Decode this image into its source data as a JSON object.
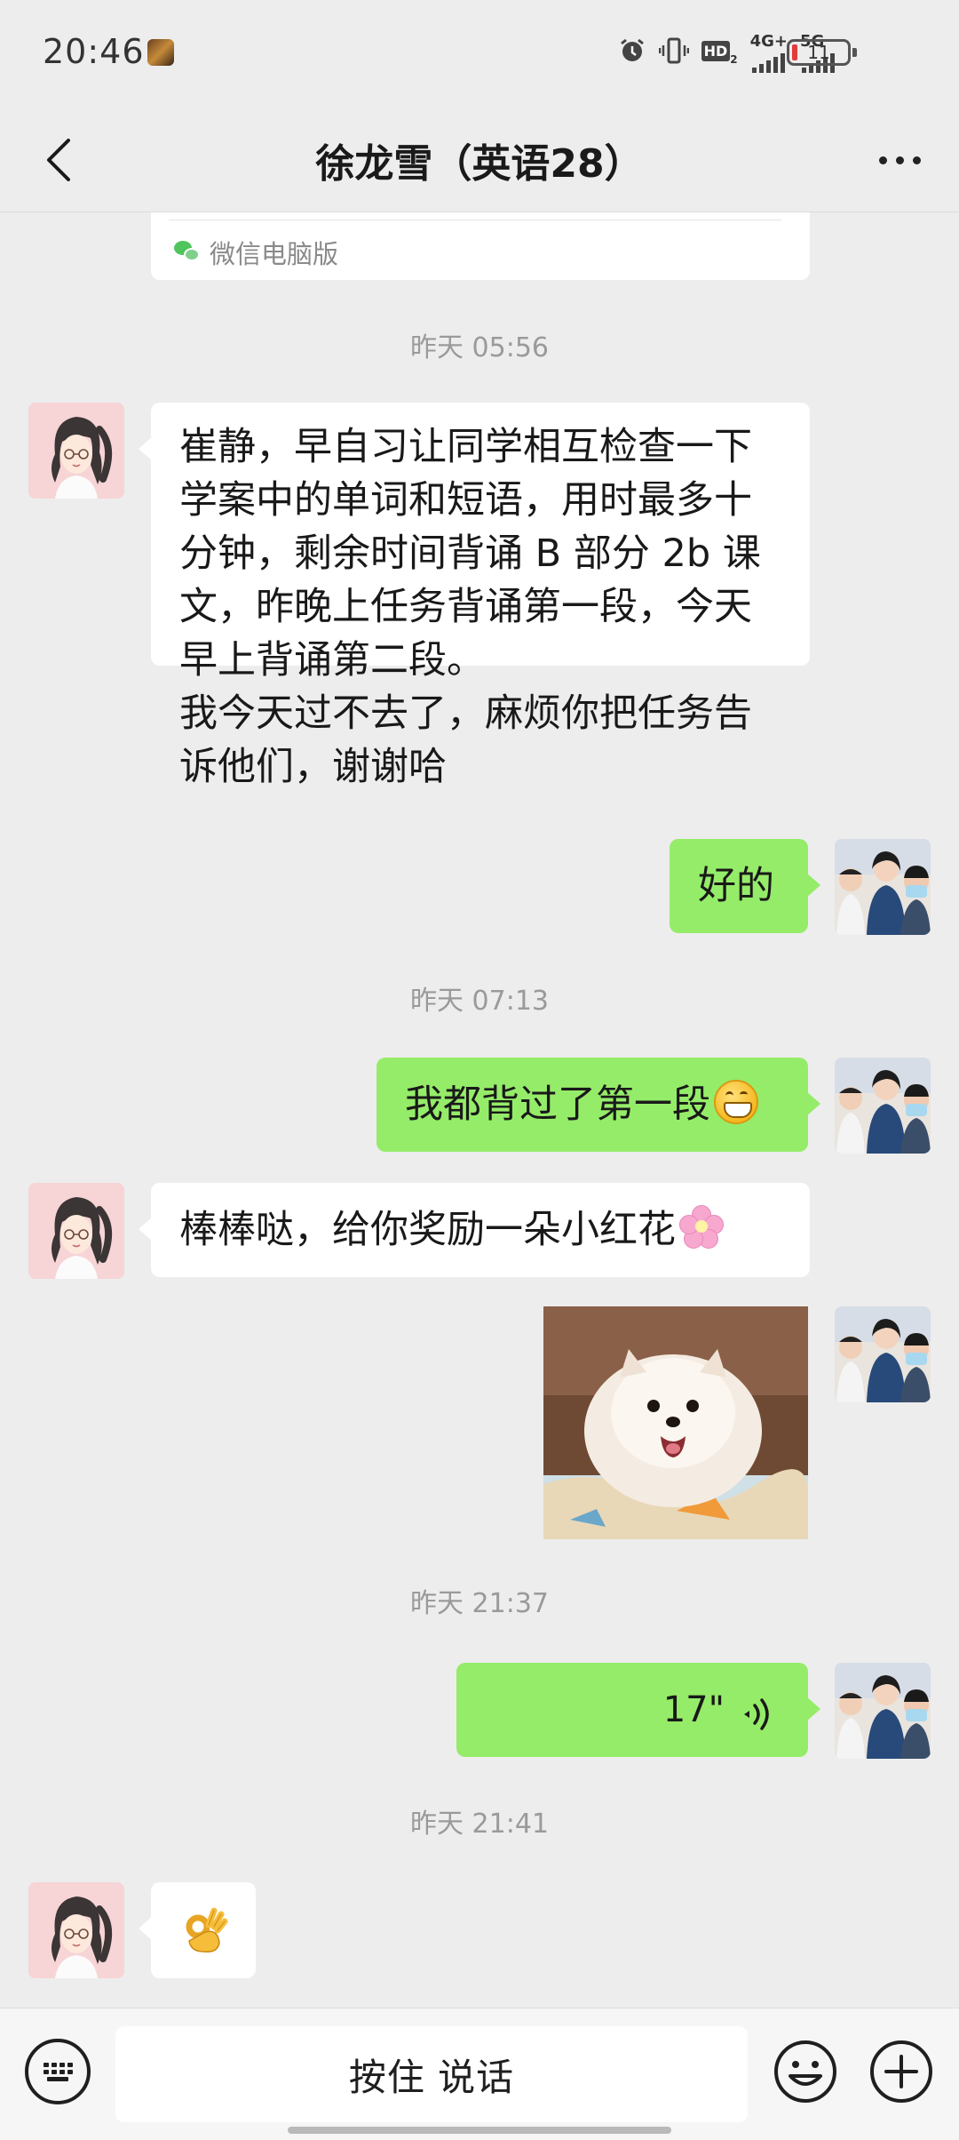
{
  "status_bar": {
    "time": "20:46",
    "hd_label": "HD",
    "network_4g": "4G+",
    "network_5g": "5G",
    "battery": "11",
    "battery_low_color": "#e23b3b"
  },
  "nav": {
    "title": "徐龙雪（英语28）",
    "back_icon": "chevron-left-icon",
    "more_icon": "more-dots-icon"
  },
  "chat": {
    "link_card_source": "微信电脑版",
    "time_1": "昨天 05:56",
    "msg_1": "崔静，早自习让同学相互检查一下学案中的单词和短语，用时最多十分钟，剩余时间背诵 B 部分 2b 课文，昨晚上任务背诵第一段，今天早上背诵第二段。\n我今天过不去了，麻烦你把任务告诉他们，谢谢哈",
    "msg_2": "好的",
    "time_2": "昨天 07:13",
    "msg_3": "我都背过了第一段",
    "msg_4": "棒棒哒，给你奖励一朵小红花",
    "time_3": "昨天 21:37",
    "voice_duration": "17\"",
    "time_4": "昨天 21:41",
    "outgoing_bubble_color": "#95ec69"
  },
  "input_bar": {
    "hold_to_talk": "按住 说话",
    "keyboard_icon": "keyboard-icon",
    "emoji_icon": "smile-icon",
    "plus_icon": "plus-circle-icon"
  }
}
